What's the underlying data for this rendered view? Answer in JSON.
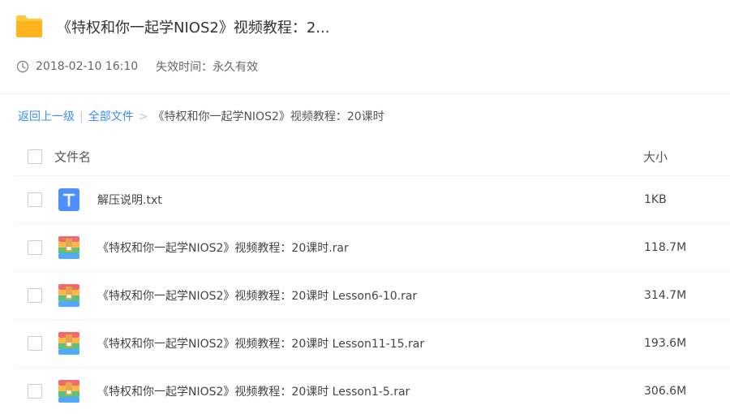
{
  "header": {
    "title": "《特权和你一起学NIOS2》视频教程：2...",
    "date": "2018-02-10 16:10",
    "expire": "失效时间：永久有效"
  },
  "breadcrumb": {
    "back": "返回上一级",
    "divider": "|",
    "all_files": "全部文件",
    "arrow": ">",
    "current": "《特权和你一起学NIOS2》视频教程：20课时"
  },
  "table": {
    "col_name": "文件名",
    "col_size": "大小",
    "files": [
      {
        "name": "解压说明.txt",
        "size": "1KB",
        "icon": "txt-file-icon"
      },
      {
        "name": "《特权和你一起学NIOS2》视频教程：20课时.rar",
        "size": "118.7M",
        "icon": "rar-file-icon"
      },
      {
        "name": "《特权和你一起学NIOS2》视频教程：20课时 Lesson6-10.rar",
        "size": "314.7M",
        "icon": "rar-file-icon"
      },
      {
        "name": "《特权和你一起学NIOS2》视频教程：20课时 Lesson11-15.rar",
        "size": "193.6M",
        "icon": "rar-file-icon"
      },
      {
        "name": "《特权和你一起学NIOS2》视频教程：20课时 Lesson1-5.rar",
        "size": "306.6M",
        "icon": "rar-file-icon"
      }
    ]
  },
  "colors": {
    "link": "#3b8cff",
    "folder": "#ffc93c",
    "txt_icon": "#4d90fe"
  }
}
